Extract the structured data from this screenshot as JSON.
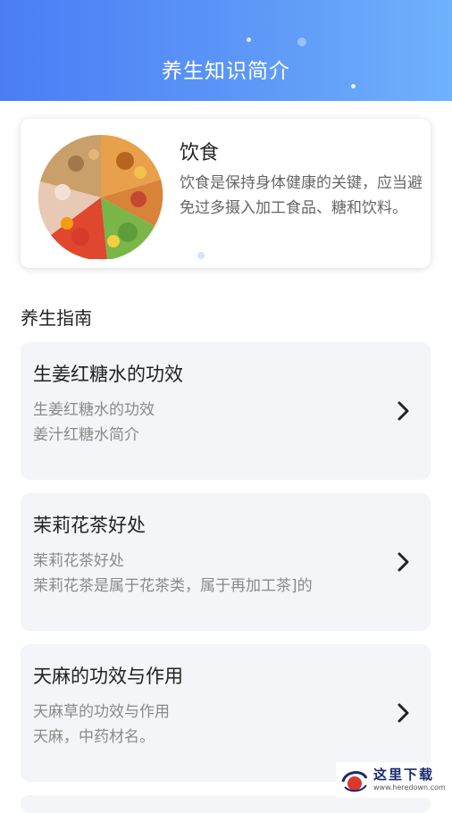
{
  "header": {
    "title": "养生知识简介"
  },
  "banner": {
    "title": "饮食",
    "description": "饮食是保持身体健康的关键，应当避免过多摄入加工食品、糖和饮料。"
  },
  "section": {
    "title": "养生指南"
  },
  "articles": [
    {
      "title": "生姜红糖水的功效",
      "subtitle": "生姜红糖水的功效",
      "summary": "姜汁红糖水简介"
    },
    {
      "title": "茉莉花茶好处",
      "subtitle": "茉莉花茶好处",
      "summary": "茉莉花茶是属于花茶类，属于再加工茶]的"
    },
    {
      "title": "天麻的功效与作用",
      "subtitle": "天麻草的功效与作用",
      "summary": "天麻，中药材名。"
    }
  ],
  "watermark": {
    "text": "这里下载",
    "url": "www.heredown.com"
  },
  "colors": {
    "header_start": "#4a7df5",
    "header_end": "#6eb2fb",
    "card_bg": "#f4f5f8"
  },
  "icons": {
    "chevron": "chevron-right-icon"
  }
}
